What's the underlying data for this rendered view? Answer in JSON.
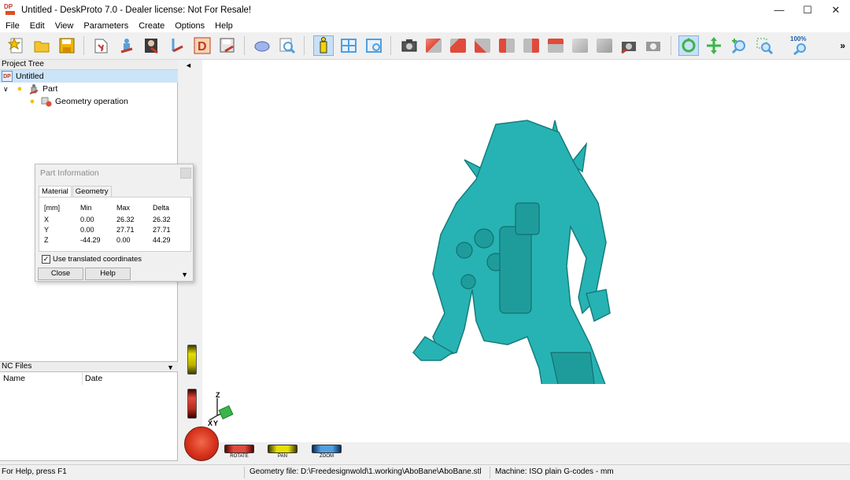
{
  "window": {
    "title": "Untitled - DeskProto 7.0 - Dealer license: Not For Resale!",
    "app_icon_text": "DP"
  },
  "window_controls": {
    "minimize": "—",
    "maximize": "☐",
    "close": "✕"
  },
  "menu": [
    "File",
    "Edit",
    "View",
    "Parameters",
    "Create",
    "Options",
    "Help"
  ],
  "toolbar": {
    "zoom_text": "100%",
    "more": "»",
    "colors": {
      "cube_red": "#e04a3a",
      "cube_gray": "#bcbcbc",
      "accent_blue": "#4f9fe0",
      "green": "#3bb54a"
    }
  },
  "project_tree": {
    "header": "Project Tree",
    "items": [
      {
        "label": "Untitled",
        "icon": "project-icon"
      },
      {
        "label": "Part",
        "icon": "part-icon",
        "expander": "∨"
      },
      {
        "label": "Geometry operation",
        "icon": "geometry-operation-icon"
      }
    ]
  },
  "nc_files": {
    "header": "NC Files",
    "dropdown": "▼",
    "columns": [
      "Name",
      "Date"
    ]
  },
  "part_info": {
    "title": "Part Information",
    "tabs": [
      "Material",
      "Geometry"
    ],
    "table": {
      "headers": [
        "[mm]",
        "Min",
        "Max",
        "Delta"
      ],
      "rows": [
        [
          "X",
          "0.00",
          "26.32",
          "26.32"
        ],
        [
          "Y",
          "0.00",
          "27.71",
          "27.71"
        ],
        [
          "Z",
          "-44.29",
          "0.00",
          "44.29"
        ]
      ]
    },
    "checkbox": {
      "label": "Use translated coordinates",
      "checked": true,
      "mark": "✓"
    },
    "buttons": {
      "close": "Close",
      "help": "Help"
    },
    "arrow": "▼"
  },
  "viewport": {
    "model_color": "#27b3b3",
    "axes": {
      "x": "X",
      "y": "Y",
      "z": "Z"
    },
    "controls": {
      "rotate": "ROTATE",
      "pan": "PAN",
      "zoom": "ZOOM"
    },
    "collapse": "◄"
  },
  "status": {
    "help": "For Help, press F1",
    "geometry": "Geometry file: D:\\Freedesignwold\\1.working\\AboBane\\AboBane.stl",
    "machine": "Machine: ISO plain G-codes - mm"
  }
}
